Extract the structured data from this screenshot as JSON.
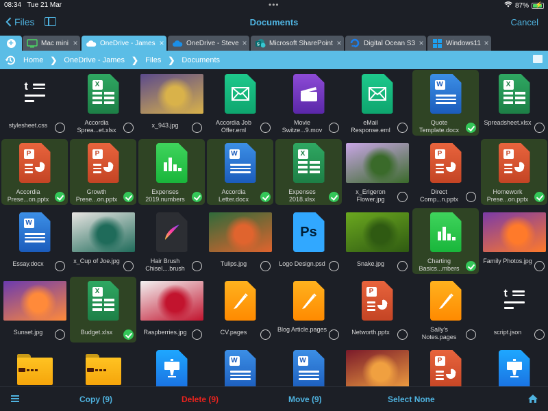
{
  "status_bar": {
    "time": "08:34",
    "date": "Tue 21 Mar",
    "battery": "87%"
  },
  "nav": {
    "back_label": "Files",
    "title": "Documents",
    "cancel_label": "Cancel"
  },
  "tabs": [
    {
      "label": "Mac mini",
      "icon": "monitor-icon",
      "active": false
    },
    {
      "label": "OneDrive - James",
      "icon": "cloud-icon",
      "active": true
    },
    {
      "label": "OneDrive - Steve",
      "icon": "onedrive-icon",
      "active": false
    },
    {
      "label": "Microsoft SharePoint",
      "icon": "sharepoint-icon",
      "active": false
    },
    {
      "label": "Digital Ocean S3",
      "icon": "digitalocean-icon",
      "active": false
    },
    {
      "label": "Windows11",
      "icon": "windows-icon",
      "active": false
    }
  ],
  "breadcrumb": [
    "Home",
    "OneDrive - James",
    "Files",
    "Documents"
  ],
  "files": [
    {
      "name": "stylesheet.css",
      "type": "text",
      "selected": false
    },
    {
      "name": "Accordia Sprea...et.xlsx",
      "type": "excel",
      "selected": false
    },
    {
      "name": "x_943.jpg",
      "type": "photo",
      "selected": false
    },
    {
      "name": "Accordia Job Offer.eml",
      "type": "mail",
      "selected": false
    },
    {
      "name": "Movie Switze...9.mov",
      "type": "movie",
      "selected": false
    },
    {
      "name": "eMail Response.eml",
      "type": "mail",
      "selected": false
    },
    {
      "name": "Quote Template.docx",
      "type": "word",
      "selected": true
    },
    {
      "name": "Spreadsheet.xlsx",
      "type": "excel",
      "selected": false
    },
    {
      "name": "Accordia Prese...on.pptx",
      "type": "ppt",
      "selected": true
    },
    {
      "name": "Growth Prese...on.pptx",
      "type": "ppt",
      "selected": true
    },
    {
      "name": "Expenses 2019.numbers",
      "type": "numbers",
      "selected": true
    },
    {
      "name": "Accordia Letter.docx",
      "type": "word",
      "selected": true
    },
    {
      "name": "Expenses 2018.xlsx",
      "type": "excel",
      "selected": true
    },
    {
      "name": "x_Erigeron Flower.jpg",
      "type": "photo",
      "selected": false
    },
    {
      "name": "Direct Comp...n.pptx",
      "type": "ppt",
      "selected": false
    },
    {
      "name": "Homework Prese...on.pptx",
      "type": "ppt",
      "selected": true
    },
    {
      "name": "Essay.docx",
      "type": "word",
      "selected": false
    },
    {
      "name": "x_Cup of Joe.jpg",
      "type": "photo",
      "selected": false
    },
    {
      "name": "Hair Brush Chisel....brush",
      "type": "procreate",
      "selected": false
    },
    {
      "name": "Tulips.jpg",
      "type": "photo",
      "selected": false
    },
    {
      "name": "Logo Design.psd",
      "type": "ps",
      "selected": false
    },
    {
      "name": "Snake.jpg",
      "type": "photo",
      "selected": false
    },
    {
      "name": "Charting Basics...mbers",
      "type": "numbers",
      "selected": true
    },
    {
      "name": "Family Photos.jpg",
      "type": "photo",
      "selected": false
    },
    {
      "name": "Sunset.jpg",
      "type": "photo",
      "selected": false
    },
    {
      "name": "Budget.xlsx",
      "type": "excel",
      "selected": true
    },
    {
      "name": "Raspberries.jpg",
      "type": "photo",
      "selected": false
    },
    {
      "name": "CV.pages",
      "type": "pages",
      "selected": false
    },
    {
      "name": "Blog Article.pages",
      "type": "pages",
      "selected": false
    },
    {
      "name": "Networth.pptx",
      "type": "ppt",
      "selected": false
    },
    {
      "name": "Sally's Notes.pages",
      "type": "pages",
      "selected": false
    },
    {
      "name": "script.json",
      "type": "text",
      "selected": false
    },
    {
      "name": "",
      "type": "zipfolder",
      "selected": false
    },
    {
      "name": "",
      "type": "zipfolder",
      "selected": false
    },
    {
      "name": "",
      "type": "keynote",
      "selected": false
    },
    {
      "name": "",
      "type": "word",
      "selected": false
    },
    {
      "name": "",
      "type": "word",
      "selected": false
    },
    {
      "name": "",
      "type": "photo",
      "selected": false
    },
    {
      "name": "",
      "type": "ppt",
      "selected": false
    },
    {
      "name": "",
      "type": "keynote",
      "selected": false
    }
  ],
  "photo_colors": {
    "x_943.jpg": [
      "#5b4a8c",
      "#d9b24a"
    ],
    "x_Erigeron Flower.jpg": [
      "#c9a6e6",
      "#3a6a2a"
    ],
    "x_Cup of Joe.jpg": [
      "#e8e4e2",
      "#1f6b5a"
    ],
    "Tulips.jpg": [
      "#2f6a3a",
      "#e0642e"
    ],
    "Snake.jpg": [
      "#6ba81f",
      "#2f5a12"
    ],
    "Family Photos.jpg": [
      "#7a3aa8",
      "#ff7a2a"
    ],
    "Sunset.jpg": [
      "#6a3ab0",
      "#ff8a3a"
    ],
    "Raspberries.jpg": [
      "#f2f2f2",
      "#c2142e"
    ],
    "fruit": [
      "#7a1a2a",
      "#f0a040"
    ]
  },
  "toolbar": {
    "copy_label": "Copy (9)",
    "delete_label": "Delete (9)",
    "move_label": "Move (9)",
    "select_none_label": "Select None",
    "accent": "#4fb3e0",
    "danger": "#e8231e"
  }
}
